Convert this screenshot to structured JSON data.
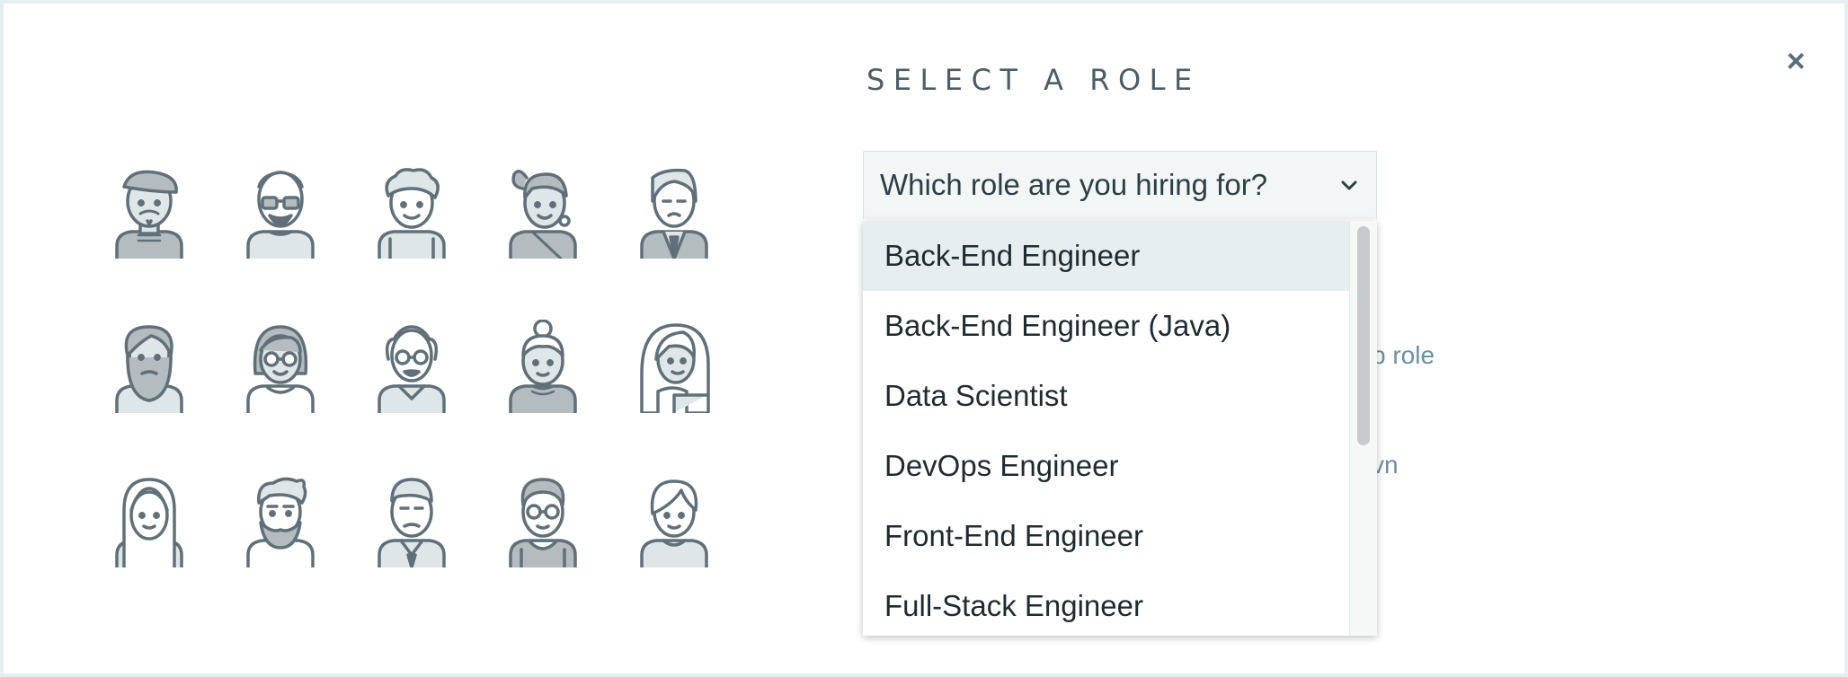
{
  "dialog": {
    "title": "SELECT A ROLE",
    "close_label": "×"
  },
  "role_select": {
    "placeholder": "Which role are you hiring for?",
    "options": [
      {
        "label": "Back-End Engineer",
        "highlighted": true
      },
      {
        "label": "Back-End Engineer (Java)",
        "highlighted": false
      },
      {
        "label": "Data Scientist",
        "highlighted": false
      },
      {
        "label": "DevOps Engineer",
        "highlighted": false
      },
      {
        "label": "Front-End Engineer",
        "highlighted": false
      },
      {
        "label": "Full-Stack Engineer",
        "highlighted": false
      }
    ]
  },
  "background_text": {
    "fragment_1": "b role",
    "fragment_2": "vn"
  },
  "colors": {
    "avatar_stroke": "#617078",
    "avatar_fill": "#b4bcc0",
    "avatar_light": "#dfe6e8",
    "highlight": "#e6eeef"
  },
  "avatars": [
    "avatar-beret-moustache",
    "avatar-bald-glasses",
    "avatar-curly-hair",
    "avatar-ponytail-earrings",
    "avatar-suit-tie",
    "avatar-full-beard",
    "avatar-bob-glasses",
    "avatar-older-glasses",
    "avatar-bun",
    "avatar-long-hair-side",
    "avatar-long-hair",
    "avatar-quiff-beard",
    "avatar-shirt-tie",
    "avatar-glasses-sweater",
    "avatar-side-part"
  ]
}
